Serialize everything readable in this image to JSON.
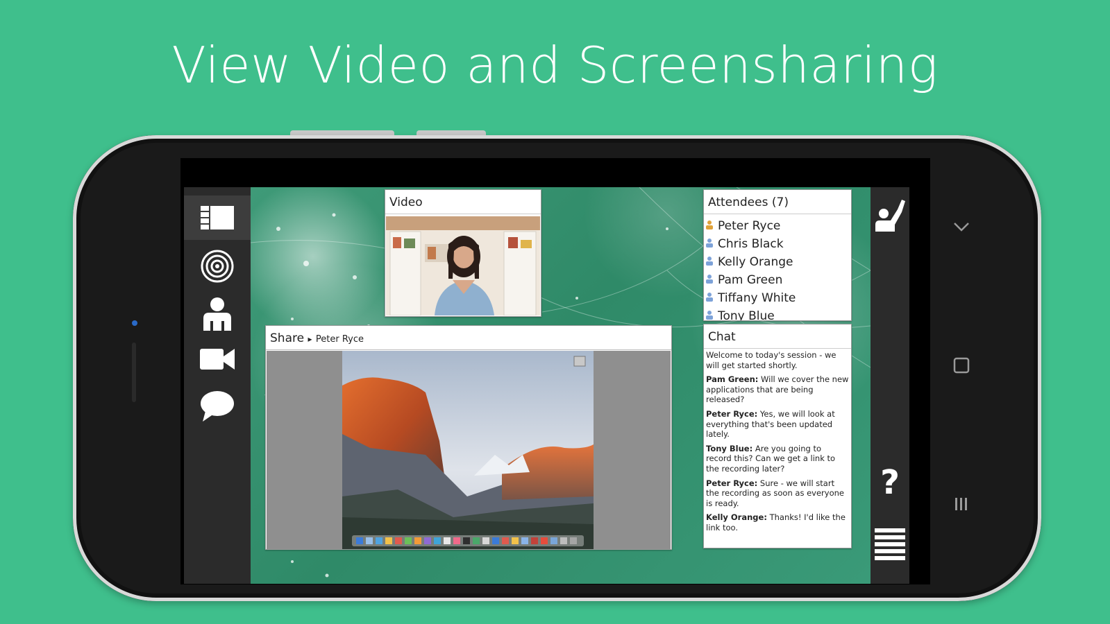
{
  "headline": "View Video and Screensharing",
  "left_toolbar": [
    {
      "name": "layouts-icon"
    },
    {
      "name": "broadcast-icon"
    },
    {
      "name": "attendee-icon"
    },
    {
      "name": "camera-icon"
    },
    {
      "name": "chat-bubble-icon"
    }
  ],
  "video_pod": {
    "title": "Video"
  },
  "share_pod": {
    "title": "Share",
    "presenter": "Peter Ryce"
  },
  "attendees_pod": {
    "title": "Attendees (7)",
    "attendees": [
      "Peter Ryce",
      "Chris Black",
      "Kelly Orange",
      "Pam Green",
      "Tiffany White",
      "Tony Blue"
    ]
  },
  "chat_pod": {
    "title": "Chat",
    "messages": [
      {
        "sender": "",
        "text": "Welcome to today's session - we will get started shortly."
      },
      {
        "sender": "Pam Green:",
        "text": " Will we cover the new applications that are being released?"
      },
      {
        "sender": "Peter Ryce:",
        "text": " Yes, we will look at everything that's been updated lately."
      },
      {
        "sender": "Tony Blue:",
        "text": " Are you going to record this? Can we get a link to the recording later?"
      },
      {
        "sender": "Peter Ryce:",
        "text": " Sure - we will start the recording as soon as everyone is ready."
      },
      {
        "sender": "Kelly Orange:",
        "text": " Thanks! I'd like the link too."
      }
    ]
  },
  "right_toolbar": {
    "help_label": "?"
  },
  "colors": {
    "background": "#3fbf8c",
    "toolbar": "#2b2b2b"
  }
}
